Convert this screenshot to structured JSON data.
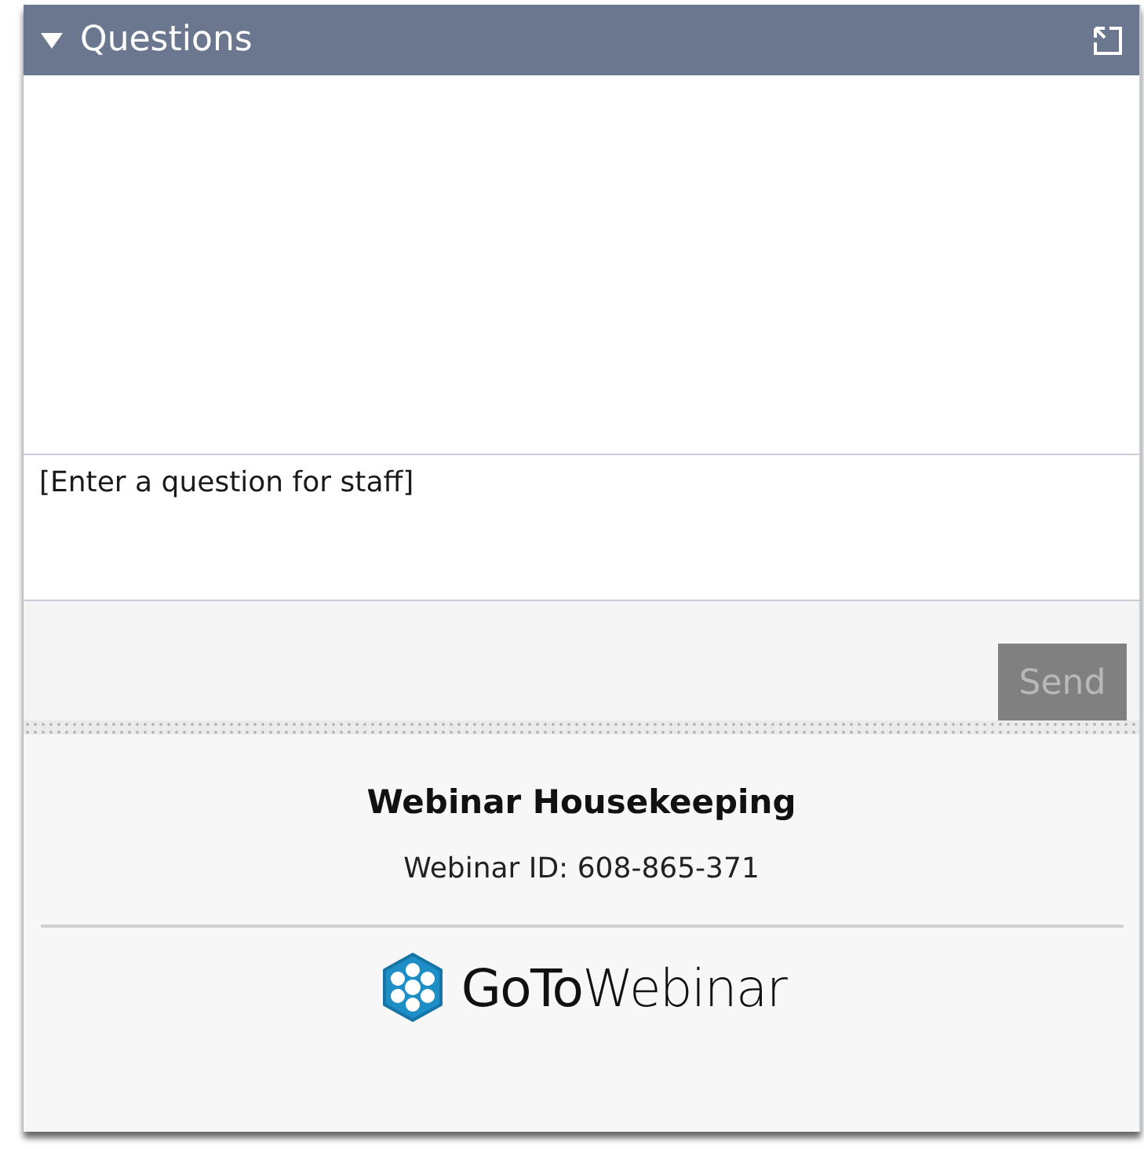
{
  "panel": {
    "title": "Questions",
    "expanded": true
  },
  "question_field": {
    "placeholder": "[Enter a question for staff]"
  },
  "send_button": {
    "label": "Send",
    "disabled": true
  },
  "footer": {
    "title": "Webinar Housekeeping",
    "webinar_id": "Webinar ID: 608-865-371",
    "logo_text": "**GoTo**Webinar"
  }
}
